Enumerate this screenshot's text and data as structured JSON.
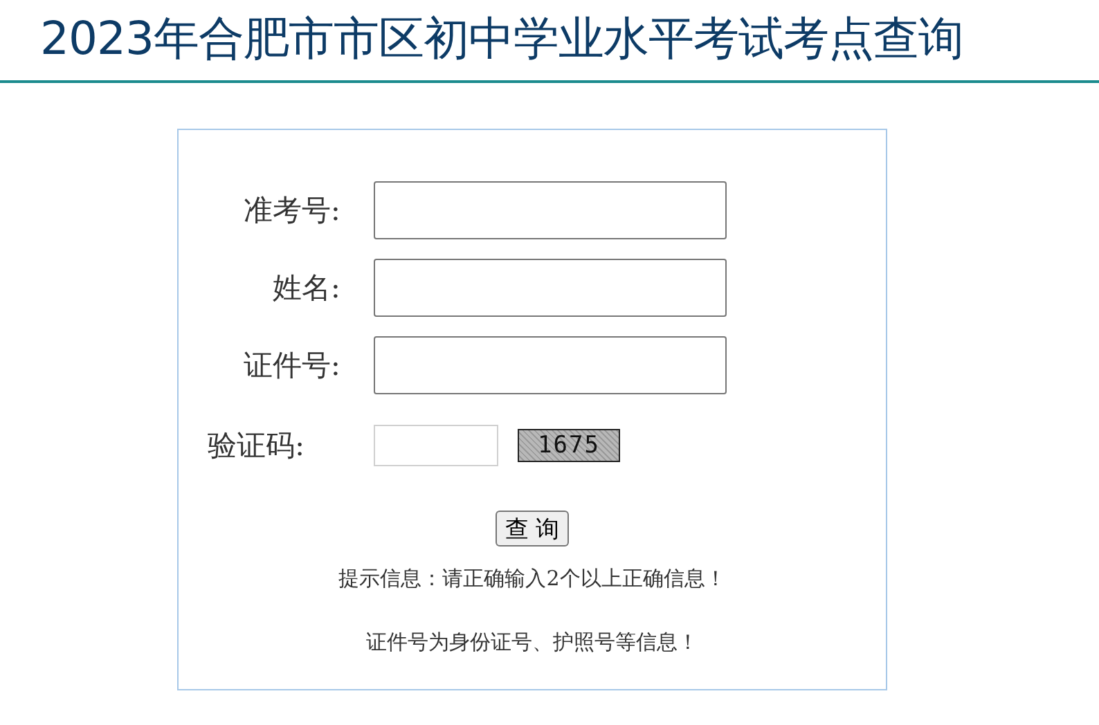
{
  "header": {
    "title": "2023年合肥市市区初中学业水平考试考点查询"
  },
  "form": {
    "fields": [
      {
        "label": "准考号:",
        "kind": "text"
      },
      {
        "label": "姓名:",
        "kind": "text"
      },
      {
        "label": "证件号:",
        "kind": "text"
      },
      {
        "label": "验证码:",
        "kind": "captcha",
        "captcha": "1675"
      }
    ],
    "button": "查 询",
    "notes": [
      "提示信息：请正确输入2个以上正确信息！",
      "证件号为身份证号、护照号等信息！"
    ]
  }
}
